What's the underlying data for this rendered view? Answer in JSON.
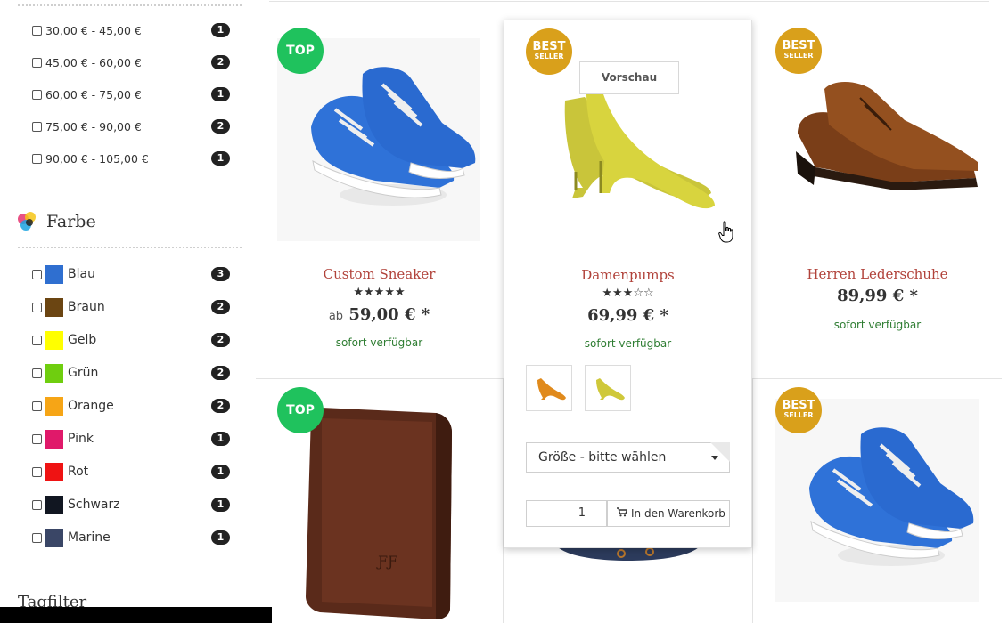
{
  "sidebar": {
    "price_filters": [
      {
        "label": "30,00 € - 45,00 €",
        "count": "1"
      },
      {
        "label": "45,00 € - 60,00 €",
        "count": "2"
      },
      {
        "label": "60,00 € - 75,00 €",
        "count": "1"
      },
      {
        "label": "75,00 € - 90,00 €",
        "count": "2"
      },
      {
        "label": "90,00 € - 105,00 €",
        "count": "1"
      }
    ],
    "color_section_title": "Farbe",
    "color_filters": [
      {
        "label": "Blau",
        "count": "3",
        "color": "#2f6fd0"
      },
      {
        "label": "Braun",
        "count": "2",
        "color": "#6b4512"
      },
      {
        "label": "Gelb",
        "count": "2",
        "color": "#ffff00"
      },
      {
        "label": "Grün",
        "count": "2",
        "color": "#6fce0f"
      },
      {
        "label": "Orange",
        "count": "2",
        "color": "#f6a516"
      },
      {
        "label": "Pink",
        "count": "1",
        "color": "#e0196a"
      },
      {
        "label": "Rot",
        "count": "1",
        "color": "#ef1313"
      },
      {
        "label": "Schwarz",
        "count": "1",
        "color": "#111621"
      },
      {
        "label": "Marine",
        "count": "1",
        "color": "#3a4666"
      }
    ],
    "tag_section_title": "Tagfilter"
  },
  "products": {
    "p1": {
      "badge": "TOP",
      "name": "Custom Sneaker",
      "stars": "★★★★★",
      "price_prefix": "ab",
      "price": "59,00 € *",
      "availability": "sofort verfügbar"
    },
    "p2": {
      "badge_line1": "BEST",
      "badge_line2": "SELLER",
      "name": "Damenpumps",
      "stars": "★★★☆☆",
      "price": "69,99 € *",
      "availability": "sofort verfügbar",
      "preview_label": "Vorschau",
      "size_select": "Größe - bitte wählen",
      "quantity": "1",
      "add_to_cart": "In den Warenkorb"
    },
    "p3": {
      "badge_line1": "BEST",
      "badge_line2": "SELLER",
      "name": "Herren Lederschuhe",
      "price": "89,99 € *",
      "availability": "sofort verfügbar"
    },
    "p4": {
      "badge": "TOP"
    },
    "p6": {
      "badge_line1": "BEST",
      "badge_line2": "SELLER"
    }
  },
  "colors": {
    "accent_name": "#b1423a",
    "availability": "#2e7d32",
    "badge_top": "#1fc25d",
    "badge_best": "#d9a01b"
  },
  "icons": [
    "palette-icon",
    "cart-icon",
    "chevron-down-icon",
    "hand-cursor-icon"
  ]
}
